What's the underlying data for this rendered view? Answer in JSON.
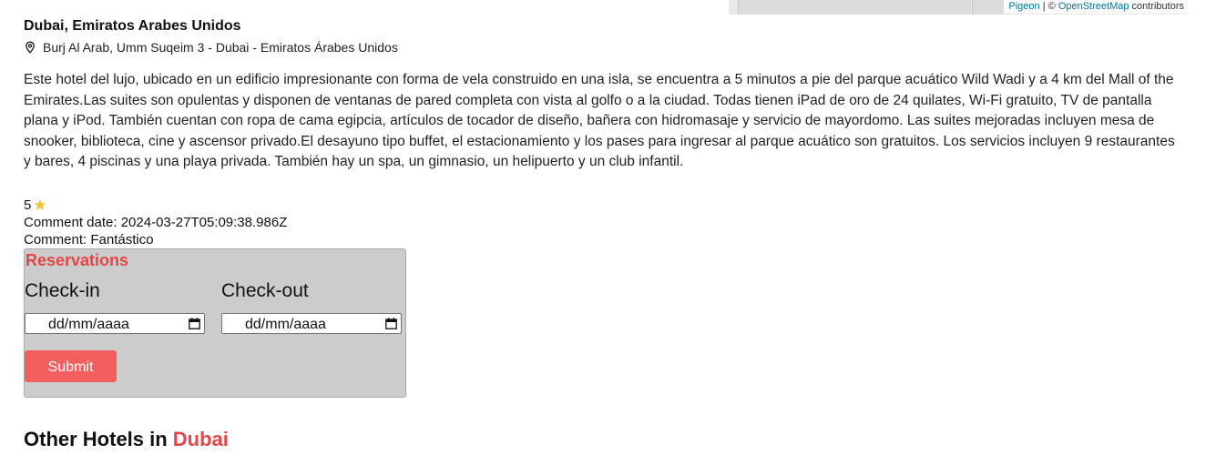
{
  "map": {
    "attribution_link1": "Pigeon",
    "attribution_separator": " | © ",
    "attribution_link2": "OpenStreetMap",
    "attribution_suffix": " contributors"
  },
  "hotel": {
    "city": "Dubai, Emiratos Arabes Unidos",
    "address": "Burj Al Arab, Umm Suqeim 3 - Dubai - Emiratos Árabes Unidos",
    "description": "Este hotel del lujo, ubicado en un edificio impresionante con forma de vela construido en una isla, se encuentra a 5 minutos a pie del parque acuático Wild Wadi y a 4 km del Mall of the Emirates.Las suites son opulentas y disponen de ventanas de pared completa con vista al golfo o a la ciudad. Todas tienen iPad de oro de 24 quilates, Wi-Fi gratuito, TV de pantalla plana y iPod. También cuentan con ropa de cama egipcia, artículos de tocador de diseño, bañera con hidromasaje y servicio de mayordomo. Las suites mejoradas incluyen mesa de snooker, biblioteca, cine y ascensor privado.El desayuno tipo buffet, el estacionamiento y los pases para ingresar al parque acuático son gratuitos. Los servicios incluyen 9 restaurantes y bares, 4 piscinas y una playa privada. También hay un spa, un gimnasio, un helipuerto y un club infantil."
  },
  "review": {
    "rating": "5",
    "date_line": "Comment date: 2024-03-27T05:09:38.986Z",
    "comment_line": "Comment: Fantástico"
  },
  "reservations": {
    "title": "Reservations",
    "checkin_label": "Check-in",
    "checkout_label": "Check-out",
    "checkin_value": "dd/mm/aaaa",
    "checkout_value": "dd/mm/aaaa",
    "submit_label": "Submit"
  },
  "other_hotels": {
    "prefix": "Other Hotels in ",
    "city": "Dubai"
  },
  "colors": {
    "accent": "#e64545",
    "button": "#f25f5f",
    "panel": "#cccccc",
    "star": "#f6c02c"
  },
  "icons": {
    "address": "location-pin-icon",
    "rating": "star-icon",
    "date": "calendar-icon"
  }
}
